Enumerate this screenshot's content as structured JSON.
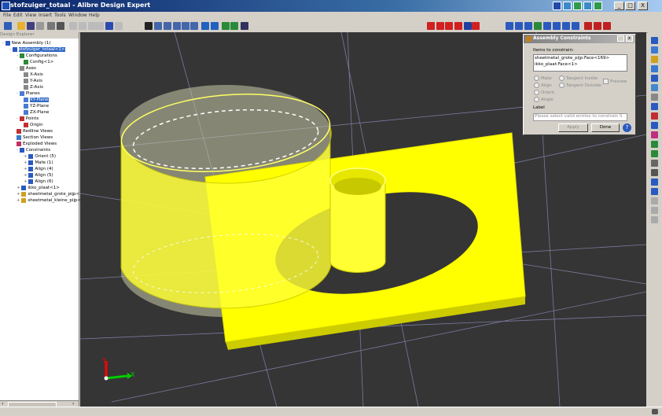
{
  "window": {
    "title": "stofzuiger_totaal - Alibre Design Expert",
    "controls": [
      "_",
      "□",
      "X"
    ]
  },
  "menu": [
    "File",
    "Edit",
    "View",
    "Insert",
    "Tools",
    "Window",
    "Help"
  ],
  "tree": {
    "header": "Design Explorer",
    "nodes": [
      {
        "label": "New Assembly (1)",
        "depth": 0,
        "icon": "assembly-icon",
        "expander": "-"
      },
      {
        "label": "stofzuiger_totaal<1>",
        "depth": 1,
        "icon": "part-icon",
        "expander": "-",
        "selected": true
      },
      {
        "label": "Configurations",
        "depth": 2,
        "icon": "config-icon",
        "expander": "-"
      },
      {
        "label": "Config<1>",
        "depth": 3,
        "icon": "config-icon",
        "expander": ""
      },
      {
        "label": "Axes",
        "depth": 2,
        "icon": "axis-icon",
        "expander": "-"
      },
      {
        "label": "X-Axis",
        "depth": 3,
        "icon": "axis-icon",
        "expander": ""
      },
      {
        "label": "Y-Axis",
        "depth": 3,
        "icon": "axis-icon",
        "expander": ""
      },
      {
        "label": "Z-Axis",
        "depth": 3,
        "icon": "axis-icon",
        "expander": ""
      },
      {
        "label": "Planes",
        "depth": 2,
        "icon": "plane-icon",
        "expander": "-"
      },
      {
        "label": "XY-Plane",
        "depth": 3,
        "icon": "plane-icon",
        "expander": "",
        "selected": true
      },
      {
        "label": "YZ-Plane",
        "depth": 3,
        "icon": "plane-icon",
        "expander": ""
      },
      {
        "label": "ZX-Plane",
        "depth": 3,
        "icon": "plane-icon",
        "expander": ""
      },
      {
        "label": "Points",
        "depth": 2,
        "icon": "point-icon",
        "expander": "-"
      },
      {
        "label": "Origin",
        "depth": 3,
        "icon": "point-icon",
        "expander": ""
      },
      {
        "label": "Redline Views",
        "depth": 2,
        "icon": "redline-icon",
        "expander": ""
      },
      {
        "label": "Section Views",
        "depth": 2,
        "icon": "section-icon",
        "expander": ""
      },
      {
        "label": "Exploded Views",
        "depth": 2,
        "icon": "exploded-icon",
        "expander": ""
      },
      {
        "label": "Constraints",
        "depth": 2,
        "icon": "constraint-icon",
        "expander": "-"
      },
      {
        "label": "Orient (5)",
        "depth": 3,
        "icon": "constraint-icon",
        "expander": "+"
      },
      {
        "label": "Mate (1)",
        "depth": 3,
        "icon": "constraint-icon",
        "expander": "+"
      },
      {
        "label": "Align (4)",
        "depth": 3,
        "icon": "constraint-icon",
        "expander": "+"
      },
      {
        "label": "Align (5)",
        "depth": 3,
        "icon": "constraint-icon",
        "expander": "+"
      },
      {
        "label": "Align (6)",
        "depth": 3,
        "icon": "constraint-icon",
        "expander": "+"
      },
      {
        "label": "ikko_plaat<1>",
        "depth": 2,
        "icon": "part-icon",
        "expander": "+"
      },
      {
        "label": "sheetmetal_grote_pijp<1",
        "depth": 2,
        "icon": "sheetmetal-icon",
        "expander": "+"
      },
      {
        "label": "sheetmetal_kleine_pijp<1",
        "depth": 2,
        "icon": "sheetmetal-icon",
        "expander": "+"
      }
    ]
  },
  "dialog": {
    "title": "Assembly Constraints",
    "items_label": "Items to constrain:",
    "items": [
      "sheetmetal_grote_pijp:Face<169>",
      "ikko_plaat:Face<1>"
    ],
    "radio_left": [
      "Mate",
      "Align",
      "Orient",
      "Angle"
    ],
    "radio_right": [
      "Tangent Inside",
      "Tangent Outside"
    ],
    "preview_label": "Preview",
    "label_caption": "Label",
    "label_placeholder": "Please select valid entries to constrain S",
    "apply": "Apply",
    "done": "Done",
    "help": "?"
  },
  "viewport": {
    "background": "#353535",
    "part_color": "#ffff00",
    "triad": {
      "x_label": "X",
      "y_label": "Y",
      "x_color": "#00cc00",
      "y_color": "#ff0000"
    }
  }
}
